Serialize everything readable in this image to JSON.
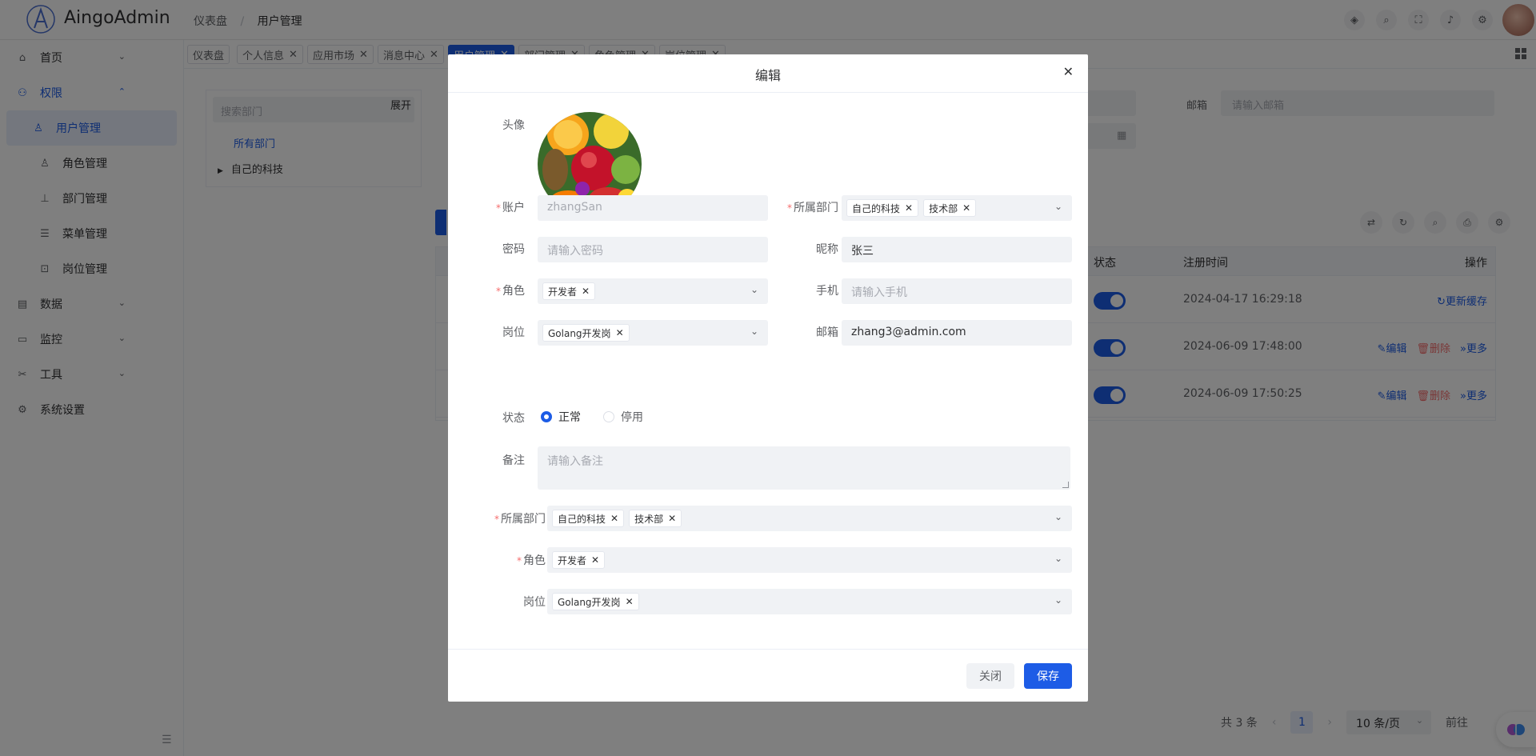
{
  "header": {
    "brand": "AingoAdmin",
    "breadcrumb": [
      "仪表盘",
      "用户管理"
    ],
    "icons": [
      "settings-node-icon",
      "search-icon",
      "fullscreen-icon",
      "bell-icon",
      "gear-icon"
    ]
  },
  "sidebar": {
    "items": [
      {
        "label": "首页",
        "icon": "home-icon"
      },
      {
        "label": "权限",
        "icon": "user-shield-icon"
      },
      {
        "label": "数据",
        "icon": "database-icon"
      },
      {
        "label": "监控",
        "icon": "monitor-icon"
      },
      {
        "label": "工具",
        "icon": "tools-icon"
      },
      {
        "label": "系统设置",
        "icon": "gear-icon"
      }
    ],
    "sub_items": [
      {
        "label": "用户管理",
        "icon": "user-icon"
      },
      {
        "label": "角色管理",
        "icon": "role-icon"
      },
      {
        "label": "部门管理",
        "icon": "org-icon"
      },
      {
        "label": "菜单管理",
        "icon": "menu-icon"
      },
      {
        "label": "岗位管理",
        "icon": "post-icon"
      }
    ]
  },
  "tags": [
    "仪表盘",
    "个人信息",
    "应用市场",
    "消息中心",
    "用户管理",
    "部门管理",
    "角色管理",
    "岗位管理"
  ],
  "background": {
    "dept_search_placeholder": "搜索部门",
    "dept_expand": "展开",
    "dept_all": "所有部门",
    "dept_child": "自己的科技",
    "email_label": "邮箱",
    "email_placeholder": "请输入邮箱",
    "table": {
      "headers": [
        "状态",
        "注册时间",
        "操作"
      ],
      "rows": [
        {
          "time": "2024-04-17 16:29:18",
          "ops": [
            "更新缓存"
          ]
        },
        {
          "time": "2024-06-09 17:48:00",
          "ops": [
            "编辑",
            "删除",
            "更多"
          ]
        },
        {
          "time": "2024-06-09 17:50:25",
          "ops": [
            "编辑",
            "删除",
            "更多"
          ]
        }
      ]
    },
    "pager": {
      "total": "共 3 条",
      "page": "1",
      "size": "10 条/页",
      "goto": "前往"
    }
  },
  "dialog": {
    "title": "编辑",
    "avatar_label": "头像",
    "account_label": "账户",
    "account_value": "zhangSan",
    "dept_label": "所属部门",
    "dept_tags": [
      "自己的科技",
      "技术部"
    ],
    "password_label": "密码",
    "password_placeholder": "请输入密码",
    "nickname_label": "昵称",
    "nickname_value": "张三",
    "role_label": "角色",
    "role_tags": [
      "开发者"
    ],
    "phone_label": "手机",
    "phone_placeholder": "请输入手机",
    "post_label": "岗位",
    "post_tags": [
      "Golang开发岗"
    ],
    "email_label": "邮箱",
    "email_value": "zhang3@admin.com",
    "status_label": "状态",
    "status_options": [
      "正常",
      "停用"
    ],
    "remark_label": "备注",
    "remark_placeholder": "请输入备注",
    "close_label": "关闭",
    "save_label": "保存"
  },
  "colors": {
    "primary": "#1d5ce6",
    "danger": "#f56c6c"
  }
}
